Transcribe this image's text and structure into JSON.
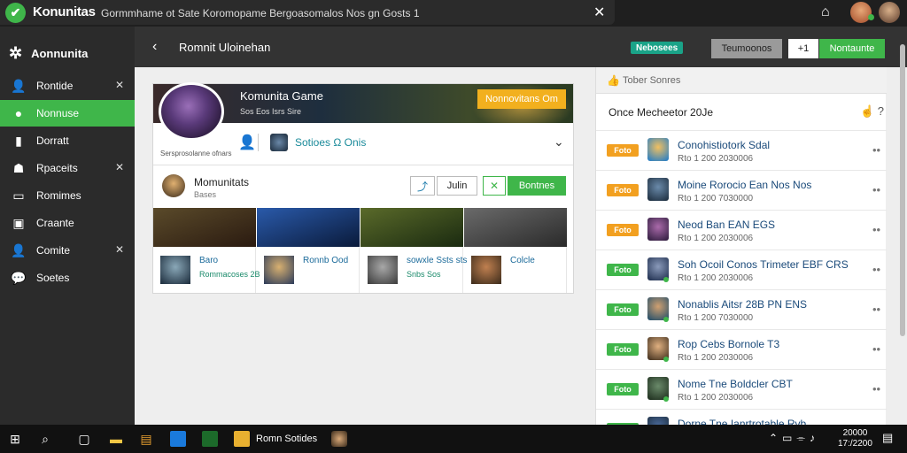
{
  "titlebar": {
    "app_name": "Konunitas",
    "window_title": "Gormmhame ot Sate Koromopame   Bergoasomalos  Nos gn Gosts  1",
    "close": "✕"
  },
  "sidebar": {
    "brand": "Aonnunita",
    "items": [
      {
        "label": "Rontide",
        "icon": "person-icon",
        "closable": true
      },
      {
        "label": "Nonnuse",
        "icon": "game-avatar-icon",
        "closable": false,
        "active": true
      },
      {
        "label": "Dorratt",
        "icon": "tablet-icon",
        "closable": false
      },
      {
        "label": "Rpaceits",
        "icon": "character-icon",
        "closable": true
      },
      {
        "label": "Romimes",
        "icon": "monitor-icon",
        "closable": false
      },
      {
        "label": "Craante",
        "icon": "portrait-icon",
        "closable": false
      },
      {
        "label": "Comite",
        "icon": "person-icon",
        "closable": true
      },
      {
        "label": "Soetes",
        "icon": "chat-icon",
        "closable": false
      }
    ]
  },
  "header": {
    "title": "Romnit Uloinehan",
    "badge": "Nebosees",
    "btn_gray": "Teumoonos",
    "btn_white": "+1",
    "btn_green": "Nontaunte"
  },
  "card": {
    "game_title": "Komunita Game",
    "game_sub": "Sos Eos Isrs Sire",
    "follow_label": "Nonnovitans  Om",
    "tagline": "Sersprosolanne ofnars",
    "row1_text": "Sotioes  Ω  Onis",
    "author_name": "Momunitats",
    "author_sub": "Bases",
    "join_label": "Julin",
    "x_label": "✕",
    "green_label": "Bontnes",
    "gallery": [
      {
        "title": "Baro",
        "sub": "Rommacoses 2B",
        "img_colors": [
          "#5a4a2a",
          "#2a1a10"
        ],
        "thumb_colors": [
          "#8aa8b8",
          "#1a2a3a"
        ]
      },
      {
        "title": "Ronnb Ood",
        "sub": "",
        "img_colors": [
          "#2a5aaa",
          "#0a1a3a"
        ],
        "thumb_colors": [
          "#d8b070",
          "#2a3a5a"
        ]
      },
      {
        "title": "sowxle Ssts sts",
        "sub": "Snbs Sos",
        "img_colors": [
          "#5a6a2a",
          "#1a2a10"
        ],
        "thumb_colors": [
          "#a8a8a8",
          "#3a3a3a"
        ]
      },
      {
        "title": "Colcle",
        "sub": "",
        "img_colors": [
          "#6a6a6a",
          "#2a2a2a"
        ],
        "thumb_colors": [
          "#c08050",
          "#3a2a1a"
        ]
      }
    ]
  },
  "panel": {
    "header": "Tober Sonres",
    "subheader": "Once Mecheetor 20Je",
    "tools": "☝ ?",
    "feed": [
      {
        "badge": "Foto",
        "badge_color": "#f2a020",
        "title": "Conohistiotork Sdal",
        "time": "Rto 1 200 2030006",
        "avatar_colors": [
          "#f2c060",
          "#1a7acc"
        ],
        "dot": false
      },
      {
        "badge": "Foto",
        "badge_color": "#f2a020",
        "title": "Moine Rorocio  Ean Nos Nos",
        "time": "Rto 1 200 7030000",
        "avatar_colors": [
          "#6a8aaa",
          "#1a2a3a"
        ],
        "dot": false
      },
      {
        "badge": "Foto",
        "badge_color": "#f2a020",
        "title": "Neod  Ban EAN  EGS",
        "time": "Rto 1 200 2030006",
        "avatar_colors": [
          "#aa6aaa",
          "#2a1a3a"
        ],
        "dot": false
      },
      {
        "badge": "Foto",
        "badge_color": "#3fb64a",
        "title": "Soh Ocoil Conos Trimeter EBF CRS",
        "time": "Rto 1 200 2030006",
        "avatar_colors": [
          "#8a9aba",
          "#1a2a4a"
        ],
        "dot": true
      },
      {
        "badge": "Foto",
        "badge_color": "#3fb64a",
        "title": "Nonablis Aitsr  28B PN ENS",
        "time": "Rto 1 200 7030000",
        "avatar_colors": [
          "#d0a070",
          "#1a4a6a"
        ],
        "dot": true
      },
      {
        "badge": "Foto",
        "badge_color": "#3fb64a",
        "title": "Rop Cebs Bornole  T3",
        "time": "Rto 1 200 2030006",
        "avatar_colors": [
          "#e0b080",
          "#3a2a1a"
        ],
        "dot": true
      },
      {
        "badge": "Foto",
        "badge_color": "#3fb64a",
        "title": "Nome Tne Boldcler CBT",
        "time": "Rto 1 200 2030006",
        "avatar_colors": [
          "#6a8a6a",
          "#1a2a1a"
        ],
        "dot": true
      },
      {
        "badge": "Foto",
        "badge_color": "#3fb64a",
        "title": "Dorne Tne Ianrtrotable Rvb",
        "time": "",
        "avatar_colors": [
          "#4a6a9a",
          "#1a2a3a"
        ],
        "dot": false
      }
    ]
  },
  "taskbar": {
    "app_label": "Romn Sotides",
    "time": "20000",
    "date": "17:/2200"
  }
}
